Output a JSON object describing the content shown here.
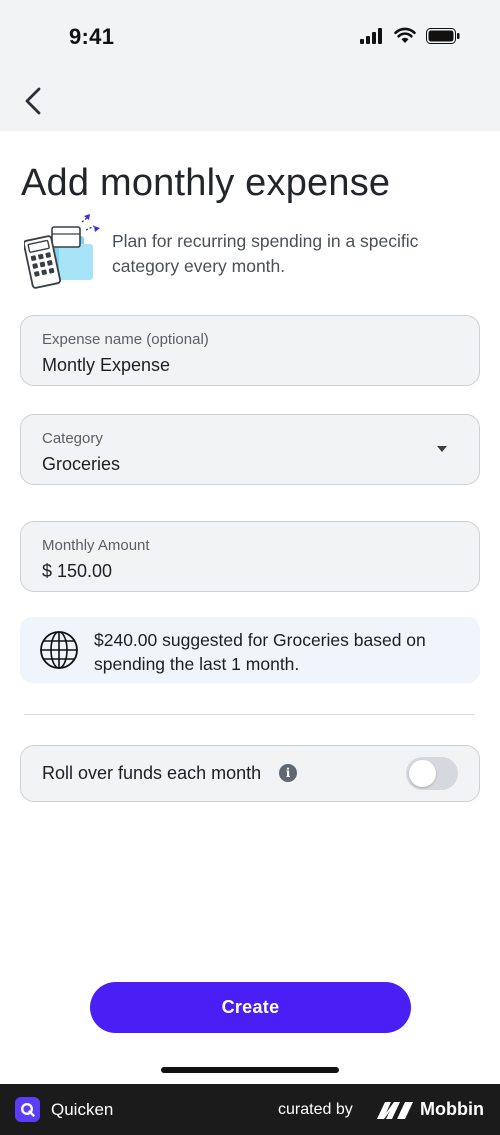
{
  "status_bar": {
    "time": "9:41"
  },
  "header": {
    "back_icon": "chevron-left-icon"
  },
  "page": {
    "title": "Add monthly expense",
    "intro": "Plan for recurring spending in a specific category every month."
  },
  "form": {
    "expense_name": {
      "label": "Expense name (optional)",
      "value": "Montly Expense"
    },
    "category": {
      "label": "Category",
      "value": "Groceries"
    },
    "monthly_amount": {
      "label": "Monthly Amount",
      "value": "$ 150.00"
    }
  },
  "suggestion": {
    "icon": "globe-icon",
    "text": "$240.00 suggested for Groceries based on spending the last 1 month."
  },
  "rollover": {
    "label": "Roll over funds each month",
    "info_glyph": "i",
    "enabled": false
  },
  "actions": {
    "create_label": "Create"
  },
  "footer": {
    "app_name": "Quicken",
    "curated_by": "curated by",
    "brand": "Mobbin"
  },
  "colors": {
    "accent": "#4a1ff5",
    "field_bg": "#f2f3f4",
    "suggestion_bg": "#eff5fb",
    "footer_bg": "#1b1b1b"
  }
}
